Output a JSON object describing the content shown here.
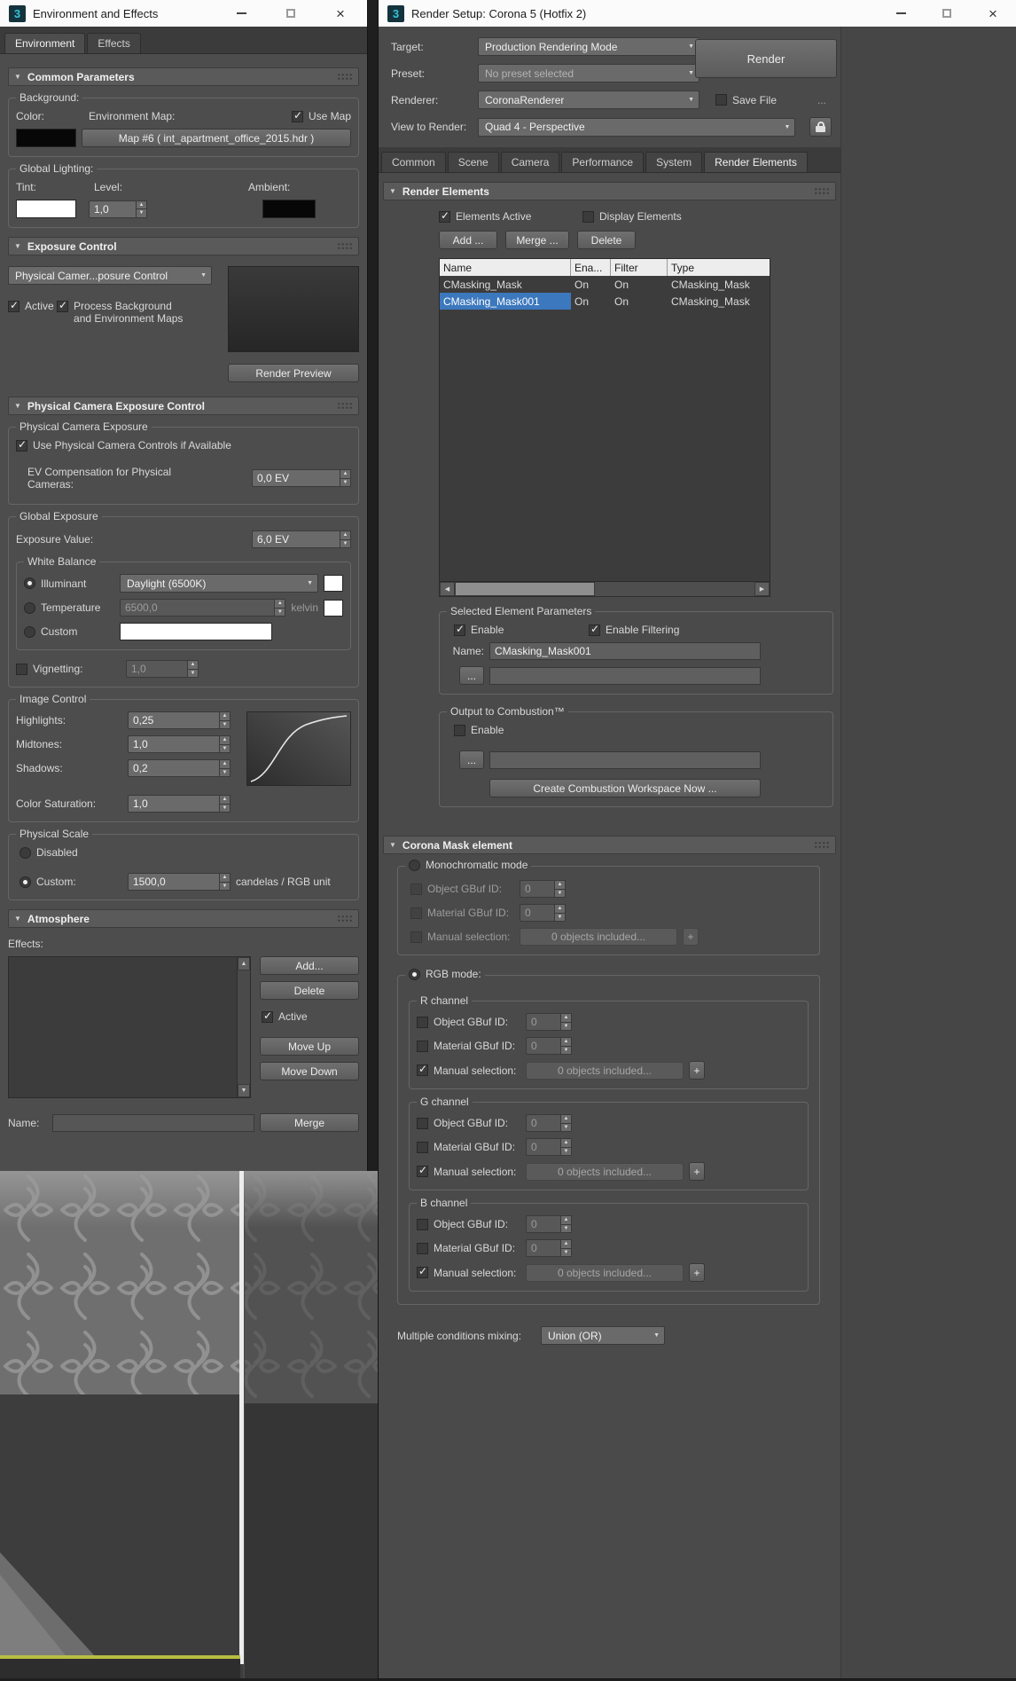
{
  "app": {
    "brand_glyph": "3"
  },
  "left_window": {
    "title": "Environment and Effects",
    "tab_environment": "Environment",
    "tab_effects": "Effects",
    "common": {
      "header": "Common Parameters",
      "background_title": "Background:",
      "color_label": "Color:",
      "background_color": "#070707",
      "env_map_label": "Environment Map:",
      "use_map_label": "Use Map",
      "use_map_checked": true,
      "map_button": "Map #6 ( int_apartment_office_2015.hdr )",
      "global_lighting_title": "Global Lighting:",
      "tint_label": "Tint:",
      "tint_color": "#ffffff",
      "level_label": "Level:",
      "level_value": "1,0",
      "ambient_label": "Ambient:",
      "ambient_color": "#070707"
    },
    "exposure": {
      "header": "Exposure Control",
      "selector_value": "Physical Camer...posure Control",
      "active_label": "Active",
      "active_checked": true,
      "process_line1": "Process Background",
      "process_line2": "and Environment Maps",
      "process_checked": true,
      "render_preview": "Render Preview"
    },
    "pcec": {
      "header": "Physical Camera Exposure Control",
      "pce": {
        "title": "Physical Camera Exposure",
        "use_controls_label": "Use Physical Camera Controls if Available",
        "use_controls_checked": true,
        "ev_line1": "EV Compensation for Physical",
        "ev_line2": "Cameras:",
        "ev_value": "0,0 EV"
      },
      "ge": {
        "title": "Global Exposure",
        "ev_label": "Exposure Value:",
        "ev_value": "6,0 EV",
        "wb": {
          "title": "White Balance",
          "illuminant_label": "Illuminant",
          "illuminant_on": true,
          "illuminant_value": "Daylight (6500K)",
          "illuminant_color": "#ffffff",
          "temperature_label": "Temperature",
          "temperature_on": false,
          "temperature_value": "6500,0",
          "temperature_unit": "kelvin",
          "temperature_color": "#ffffff",
          "custom_label": "Custom",
          "custom_on": false,
          "custom_color": "#ffffff"
        },
        "vignetting_label": "Vignetting:",
        "vignetting_checked": false,
        "vignetting_value": "1,0"
      },
      "image_control": {
        "title": "Image Control",
        "rows": [
          {
            "label": "Highlights:",
            "value": "0,25"
          },
          {
            "label": "Midtones:",
            "value": "1,0"
          },
          {
            "label": "Shadows:",
            "value": "0,2"
          },
          {
            "label": "Color Saturation:",
            "value": "1,0"
          }
        ]
      },
      "physical_scale": {
        "title": "Physical Scale",
        "disabled_label": "Disabled",
        "disabled_on": false,
        "custom_label": "Custom:",
        "custom_on": true,
        "custom_value": "1500,0",
        "custom_unit": "candelas / RGB unit"
      }
    },
    "atmosphere": {
      "header": "Atmosphere",
      "effects_label": "Effects:",
      "add": "Add...",
      "delete": "Delete",
      "active_label": "Active",
      "active_checked": true,
      "move_up": "Move Up",
      "move_down": "Move Down",
      "name_label": "Name:",
      "merge": "Merge"
    }
  },
  "right_window": {
    "title": "Render Setup: Corona 5 (Hotfix 2)",
    "target_label": "Target:",
    "target_value": "Production Rendering Mode",
    "preset_label": "Preset:",
    "preset_value": "No preset selected",
    "renderer_label": "Renderer:",
    "renderer_value": "CoronaRenderer",
    "save_file_label": "Save File",
    "save_file_checked": false,
    "more_dots": "...",
    "view_label": "View to Render:",
    "view_value": "Quad 4 - Perspective",
    "render_button": "Render",
    "tabs": [
      "Common",
      "Scene",
      "Camera",
      "Performance",
      "System",
      "Render Elements"
    ],
    "elements": {
      "header": "Render Elements",
      "elements_active_label": "Elements Active",
      "elements_active_checked": true,
      "display_elements_label": "Display Elements",
      "display_elements_checked": false,
      "add": "Add ...",
      "merge": "Merge ...",
      "delete": "Delete",
      "columns": {
        "name": "Name",
        "enabled": "Ena...",
        "filter": "Filter",
        "type": "Type"
      },
      "rows": [
        {
          "name": "CMasking_Mask",
          "enabled": "On",
          "filter": "On",
          "type": "CMasking_Mask",
          "selected": false
        },
        {
          "name": "CMasking_Mask001",
          "enabled": "On",
          "filter": "On",
          "type": "CMasking_Mask",
          "selected": true
        }
      ],
      "params": {
        "title": "Selected Element Parameters",
        "enable_label": "Enable",
        "enable_checked": true,
        "filtering_label": "Enable Filtering",
        "filtering_checked": true,
        "name_label": "Name:",
        "name_value": "CMasking_Mask001",
        "browse": "..."
      },
      "combustion": {
        "title": "Output to Combustion™",
        "enable_label": "Enable",
        "enable_checked": false,
        "browse": "...",
        "create": "Create Combustion Workspace Now ..."
      }
    },
    "mask": {
      "header": "Corona Mask element",
      "mono": {
        "label": "Monochromatic mode",
        "on": false,
        "object_label": "Object GBuf ID:",
        "object_value": "0",
        "material_label": "Material GBuf ID:",
        "material_value": "0",
        "manual_label": "Manual selection:",
        "manual_value": "0 objects included...",
        "plus": "+"
      },
      "rgb_label": "RGB mode:",
      "rgb_on": true,
      "channels": [
        {
          "title": "R channel",
          "object_label": "Object GBuf ID:",
          "object_value": "0",
          "object_checked": false,
          "material_label": "Material GBuf ID:",
          "material_value": "0",
          "material_checked": false,
          "manual_label": "Manual selection:",
          "manual_value": "0 objects included...",
          "manual_checked": true,
          "plus": "+"
        },
        {
          "title": "G channel",
          "object_label": "Object GBuf ID:",
          "object_value": "0",
          "object_checked": false,
          "material_label": "Material GBuf ID:",
          "material_value": "0",
          "material_checked": false,
          "manual_label": "Manual selection:",
          "manual_value": "0 objects included...",
          "manual_checked": true,
          "plus": "+"
        },
        {
          "title": "B channel",
          "object_label": "Object GBuf ID:",
          "object_value": "0",
          "object_checked": false,
          "material_label": "Material GBuf ID:",
          "material_value": "0",
          "material_checked": false,
          "manual_label": "Manual selection:",
          "manual_value": "0 objects included...",
          "manual_checked": true,
          "plus": "+"
        }
      ],
      "mixing_label": "Multiple conditions mixing:",
      "mixing_value": "Union (OR)"
    }
  }
}
